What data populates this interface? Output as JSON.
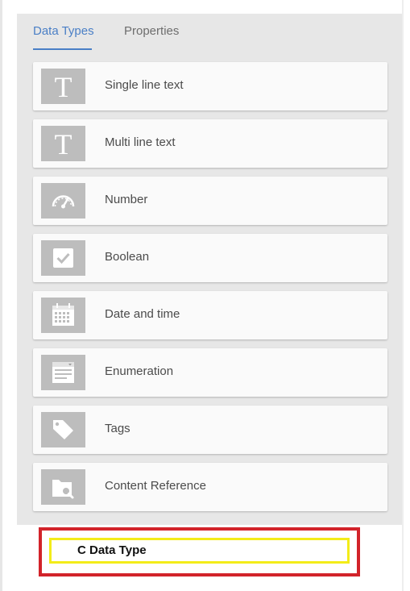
{
  "tabs": [
    {
      "label": "Data Types",
      "active": true
    },
    {
      "label": "Properties",
      "active": false
    }
  ],
  "data_types": [
    {
      "label": "Single line text",
      "icon": "text-t-icon"
    },
    {
      "label": "Multi line text",
      "icon": "text-t-icon"
    },
    {
      "label": "Number",
      "icon": "gauge-icon"
    },
    {
      "label": "Boolean",
      "icon": "checkbox-icon"
    },
    {
      "label": "Date and time",
      "icon": "calendar-icon"
    },
    {
      "label": "Enumeration",
      "icon": "list-dropdown-icon"
    },
    {
      "label": "Tags",
      "icon": "tag-icon"
    },
    {
      "label": "Content Reference",
      "icon": "folder-search-icon"
    }
  ],
  "annotation": {
    "label": "C Data Type"
  },
  "colors": {
    "accent": "#4a7fc6",
    "panel_bg": "#e7e7e7",
    "card_bg": "#fafafa",
    "icon_bg": "#bdbdbd",
    "annotation_red": "#d2232a",
    "annotation_yellow": "#f3ec19"
  }
}
